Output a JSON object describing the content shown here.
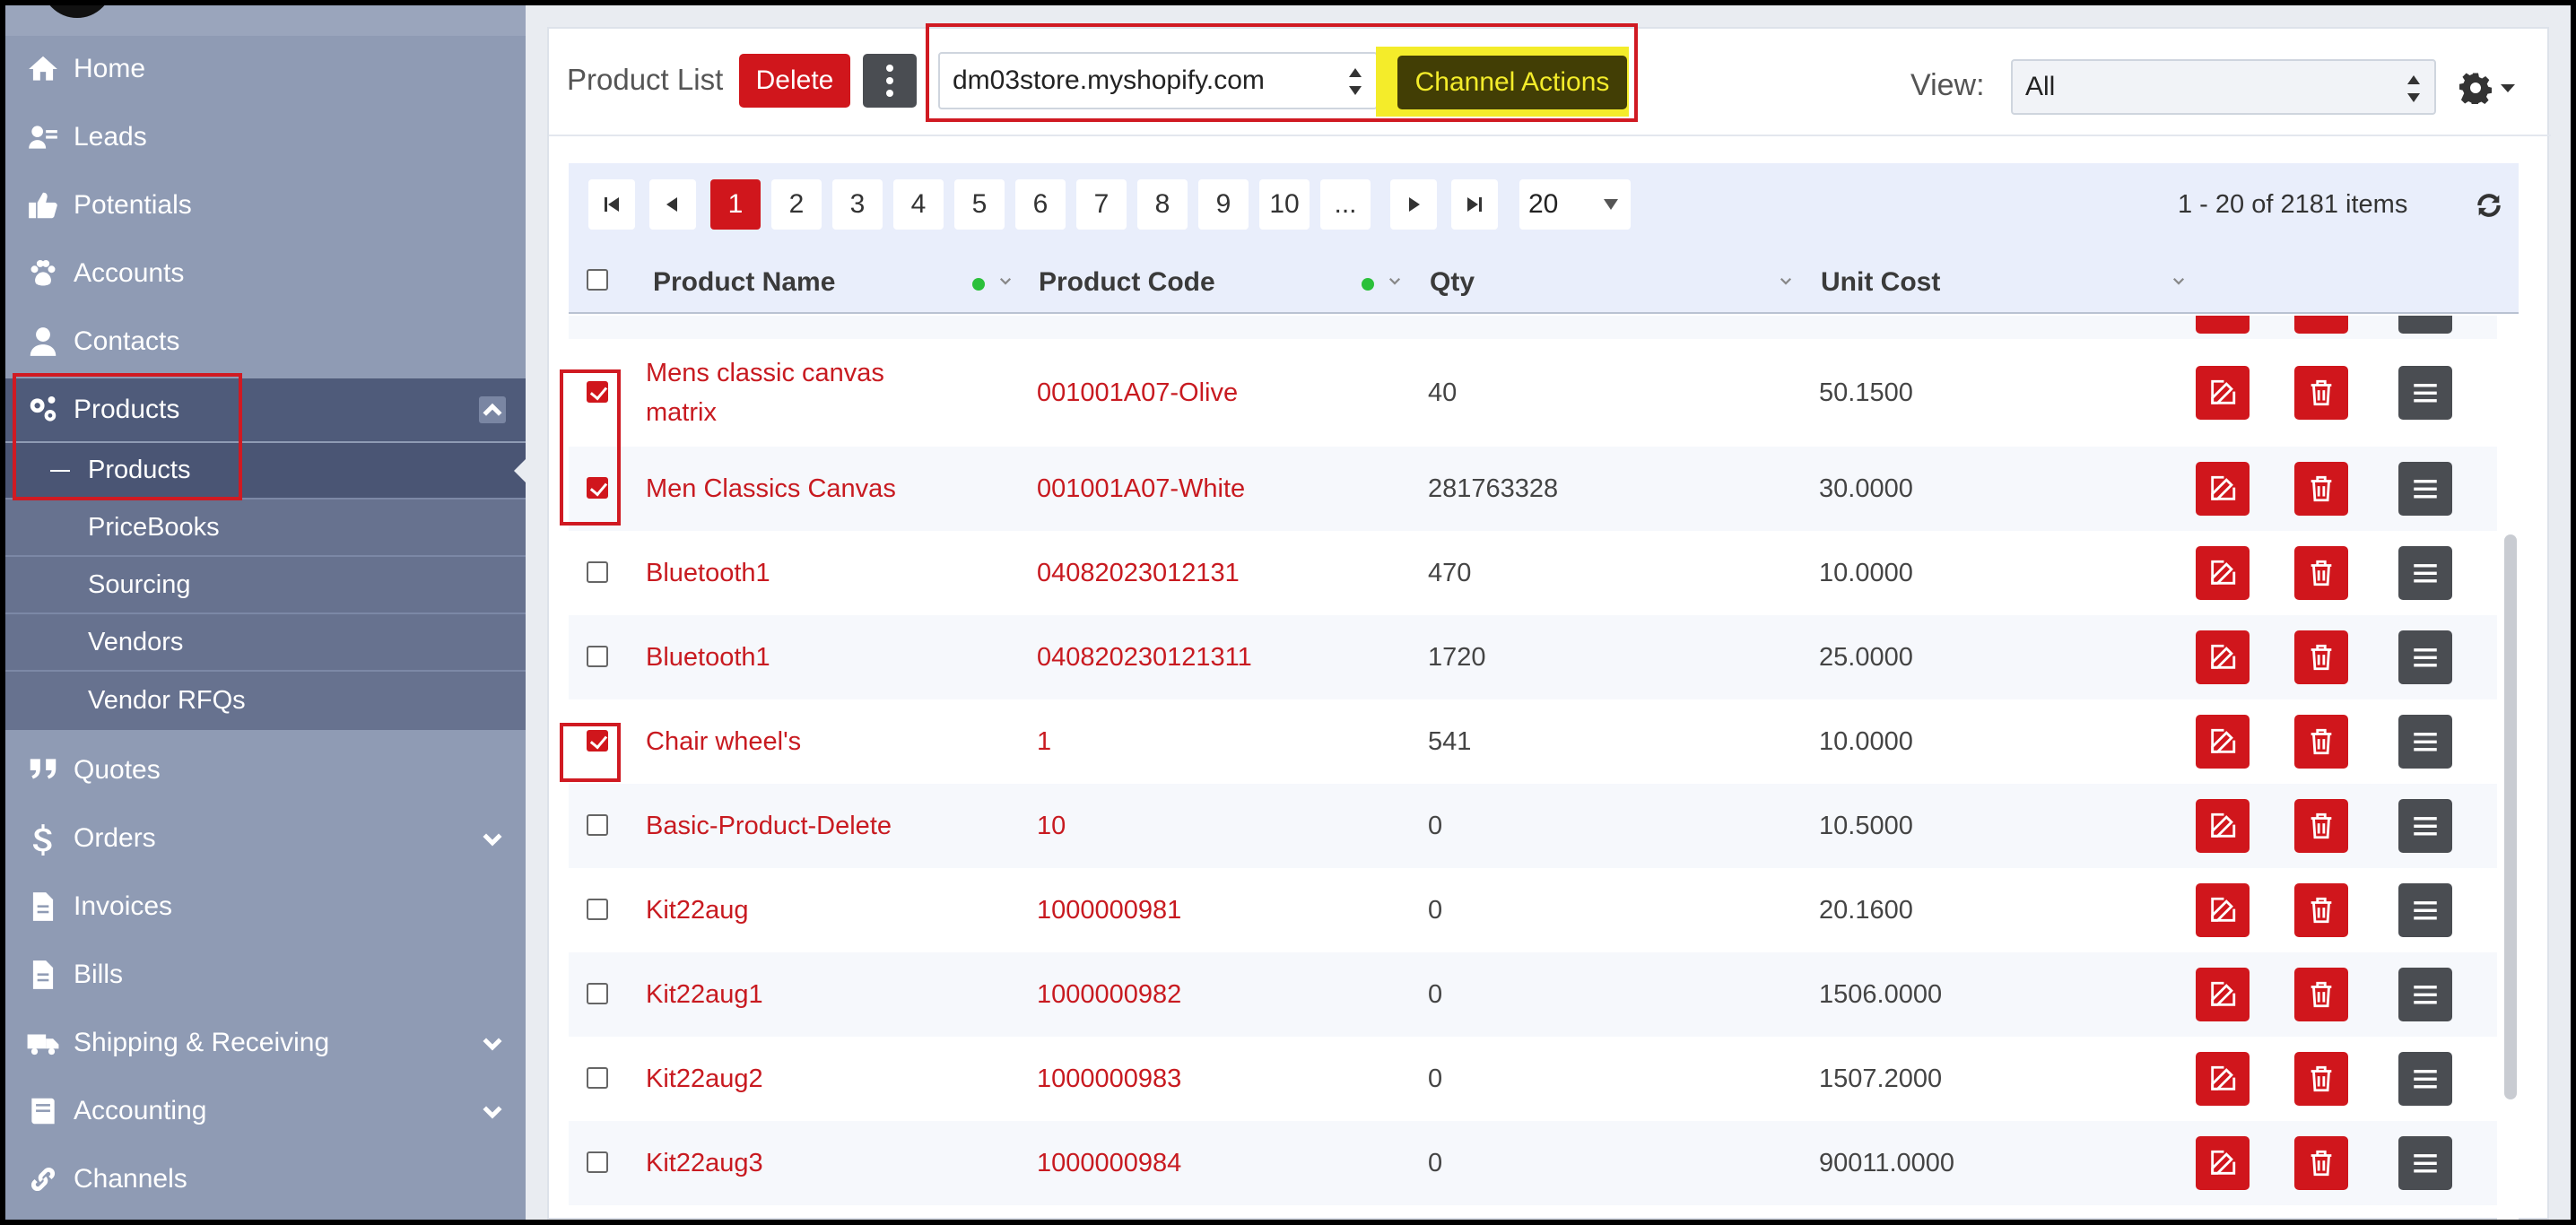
{
  "sidebar": {
    "items": [
      {
        "label": "Home",
        "icon": "home-icon"
      },
      {
        "label": "Leads",
        "icon": "leads-icon"
      },
      {
        "label": "Potentials",
        "icon": "thumbs-up-icon"
      },
      {
        "label": "Accounts",
        "icon": "paw-icon"
      },
      {
        "label": "Contacts",
        "icon": "user-icon"
      },
      {
        "label": "Products",
        "icon": "gears-icon"
      },
      {
        "label": "Quotes",
        "icon": "quote-icon"
      },
      {
        "label": "Orders",
        "icon": "dollar-icon"
      },
      {
        "label": "Invoices",
        "icon": "file-icon"
      },
      {
        "label": "Bills",
        "icon": "file-icon"
      },
      {
        "label": "Shipping & Receiving",
        "icon": "truck-icon"
      },
      {
        "label": "Accounting",
        "icon": "book-icon"
      },
      {
        "label": "Channels",
        "icon": "link-icon"
      }
    ],
    "products_sub": [
      "Products",
      "PriceBooks",
      "Sourcing",
      "Vendors",
      "Vendor RFQs"
    ]
  },
  "toolbar": {
    "title": "Product List",
    "delete_label": "Delete",
    "store": "dm03store.myshopify.com",
    "channel_actions_label": "Channel Actions",
    "view_label": "View:",
    "view_value": "All"
  },
  "pagination": {
    "pages": [
      "1",
      "2",
      "3",
      "4",
      "5",
      "6",
      "7",
      "8",
      "9",
      "10",
      "..."
    ],
    "current": "1",
    "page_size": "20",
    "items_info": "1 - 20 of 2181 items"
  },
  "table": {
    "headers": [
      "Product Name",
      "Product Code",
      "Qty",
      "Unit Cost"
    ],
    "rows": [
      {
        "name": "Mens classic canvas matrix",
        "code": "001001A07-Olive",
        "qty": "40",
        "cost": "50.1500",
        "checked": true
      },
      {
        "name": "Men Classics Canvas",
        "code": "001001A07-White",
        "qty": "281763328",
        "cost": "30.0000",
        "checked": true
      },
      {
        "name": "Bluetooth1",
        "code": "04082023012131",
        "qty": "470",
        "cost": "10.0000",
        "checked": false
      },
      {
        "name": "Bluetooth1",
        "code": "040820230121311",
        "qty": "1720",
        "cost": "25.0000",
        "checked": false
      },
      {
        "name": "Chair wheel's",
        "code": "1",
        "qty": "541",
        "cost": "10.0000",
        "checked": true
      },
      {
        "name": "Basic-Product-Delete",
        "code": "10",
        "qty": "0",
        "cost": "10.5000",
        "checked": false
      },
      {
        "name": "Kit22aug",
        "code": "1000000981",
        "qty": "0",
        "cost": "20.1600",
        "checked": false
      },
      {
        "name": "Kit22aug1",
        "code": "1000000982",
        "qty": "0",
        "cost": "1506.0000",
        "checked": false
      },
      {
        "name": "Kit22aug2",
        "code": "1000000983",
        "qty": "0",
        "cost": "1507.2000",
        "checked": false
      },
      {
        "name": "Kit22aug3",
        "code": "1000000984",
        "qty": "0",
        "cost": "90011.0000",
        "checked": false
      }
    ]
  },
  "colors": {
    "sidebar": "#8f9bb4",
    "accent_red": "#d0161c",
    "highlight_yellow": "#f4ec2a",
    "link_red": "#c81a20"
  }
}
